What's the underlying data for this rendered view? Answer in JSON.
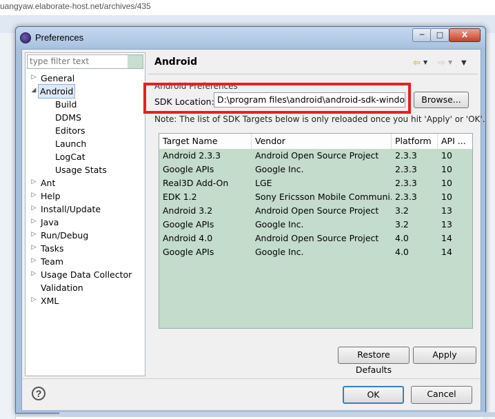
{
  "url": "uangyaw.elaborate-host.net/archives/435",
  "window": {
    "title": "Preferences",
    "buttons": {
      "minimize": "─",
      "maximize": "□",
      "close": "X"
    }
  },
  "filter": {
    "placeholder": "type filter text"
  },
  "tree": [
    {
      "label": "General",
      "indent": 0,
      "arrow": "▷"
    },
    {
      "label": "Android",
      "indent": 0,
      "arrow": "◢",
      "selected": true
    },
    {
      "label": "Build",
      "indent": 1,
      "arrow": ""
    },
    {
      "label": "DDMS",
      "indent": 1,
      "arrow": ""
    },
    {
      "label": "Editors",
      "indent": 1,
      "arrow": ""
    },
    {
      "label": "Launch",
      "indent": 1,
      "arrow": ""
    },
    {
      "label": "LogCat",
      "indent": 1,
      "arrow": ""
    },
    {
      "label": "Usage Stats",
      "indent": 1,
      "arrow": ""
    },
    {
      "label": "Ant",
      "indent": 0,
      "arrow": "▷"
    },
    {
      "label": "Help",
      "indent": 0,
      "arrow": "▷"
    },
    {
      "label": "Install/Update",
      "indent": 0,
      "arrow": "▷"
    },
    {
      "label": "Java",
      "indent": 0,
      "arrow": "▷"
    },
    {
      "label": "Run/Debug",
      "indent": 0,
      "arrow": "▷"
    },
    {
      "label": "Tasks",
      "indent": 0,
      "arrow": "▷"
    },
    {
      "label": "Team",
      "indent": 0,
      "arrow": "▷"
    },
    {
      "label": "Usage Data Collector",
      "indent": 0,
      "arrow": "▷"
    },
    {
      "label": "Validation",
      "indent": 0,
      "arrow": ""
    },
    {
      "label": "XML",
      "indent": 0,
      "arrow": "▷"
    }
  ],
  "page": {
    "title": "Android",
    "section_label": "Android Preferences",
    "sdk_label": "SDK Location:",
    "sdk_value": "D:\\program files\\android\\android-sdk-windows",
    "browse_label": "Browse...",
    "note": "Note: The list of SDK Targets below is only reloaded once you hit 'Apply' or 'OK'.",
    "nav_icons": [
      "back-arrow-icon",
      "forward-arrow-icon",
      "view-menu-icon"
    ]
  },
  "table": {
    "headers": [
      "Target Name",
      "Vendor",
      "Platform",
      "API ..."
    ],
    "rows": [
      [
        "Android 2.3.3",
        "Android Open Source Project",
        "2.3.3",
        "10"
      ],
      [
        "Google APIs",
        "Google Inc.",
        "2.3.3",
        "10"
      ],
      [
        "Real3D Add-On",
        "LGE",
        "2.3.3",
        "10"
      ],
      [
        "EDK 1.2",
        "Sony Ericsson Mobile Communi...",
        "2.3.3",
        "10"
      ],
      [
        "Android 3.2",
        "Android Open Source Project",
        "3.2",
        "13"
      ],
      [
        "Google APIs",
        "Google Inc.",
        "3.2",
        "13"
      ],
      [
        "Android 4.0",
        "Android Open Source Project",
        "4.0",
        "14"
      ],
      [
        "Google APIs",
        "Google Inc.",
        "4.0",
        "14"
      ]
    ]
  },
  "buttons": {
    "restore_defaults": "Restore Defaults",
    "apply": "Apply",
    "ok": "OK",
    "cancel": "Cancel",
    "help": "?"
  },
  "colors": {
    "highlight": "#e52022",
    "table_bg": "#c3dccb",
    "selection": "#dde9f6"
  }
}
